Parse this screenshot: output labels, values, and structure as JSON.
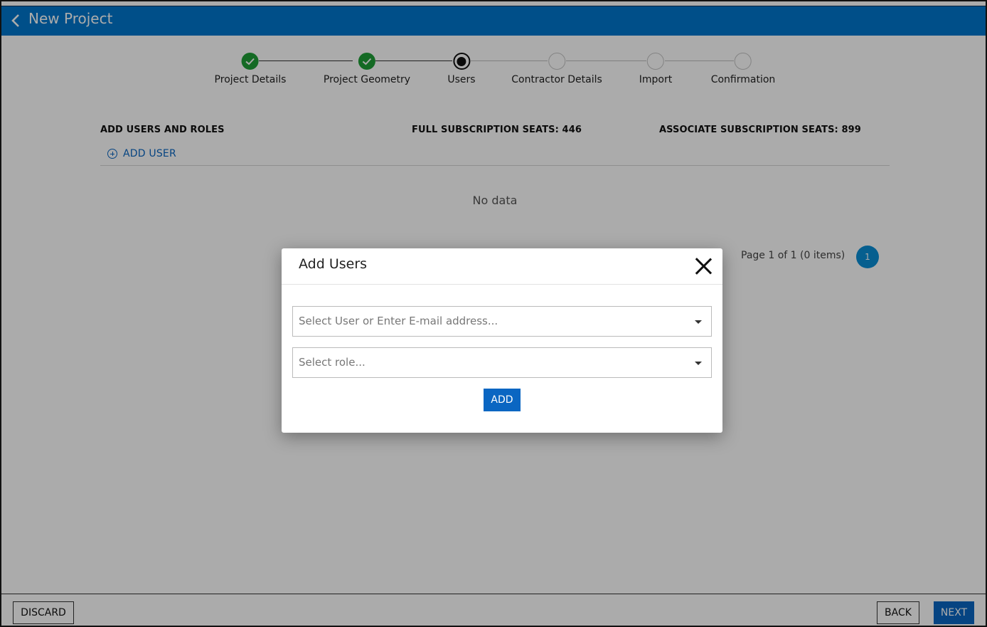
{
  "header": {
    "title": "New Project",
    "back_icon": "chevron-left-icon"
  },
  "stepper": {
    "steps": [
      {
        "label": "Project Details",
        "state": "done"
      },
      {
        "label": "Project Geometry",
        "state": "done"
      },
      {
        "label": "Users",
        "state": "active"
      },
      {
        "label": "Contractor Details",
        "state": "pending"
      },
      {
        "label": "Import",
        "state": "pending"
      },
      {
        "label": "Confirmation",
        "state": "pending"
      }
    ],
    "colors": {
      "done": "#1e9e36",
      "active": "#111111",
      "pending": "#c4c4c4"
    }
  },
  "users_section": {
    "heading": "ADD USERS AND ROLES",
    "full_seats": "FULL SUBSCRIPTION SEATS: 446",
    "associate_seats": "ASSOCIATE SUBSCRIPTION SEATS: 899",
    "add_user_label": "ADD USER",
    "add_user_icon": "plus-circle-icon",
    "empty_text": "No data",
    "pager_text": "Page 1 of 1 (0 items)",
    "current_page": "1"
  },
  "modal": {
    "title": "Add Users",
    "close_icon": "close-icon",
    "user_select_placeholder": "Select User or Enter E-mail address...",
    "role_select_placeholder": "Select role...",
    "add_button": "ADD"
  },
  "footer": {
    "discard": "DISCARD",
    "back": "BACK",
    "next": "NEXT"
  },
  "colors": {
    "header_bg": "#0077cc",
    "primary": "#0a66c2",
    "page_badge": "#0a8ed6"
  }
}
